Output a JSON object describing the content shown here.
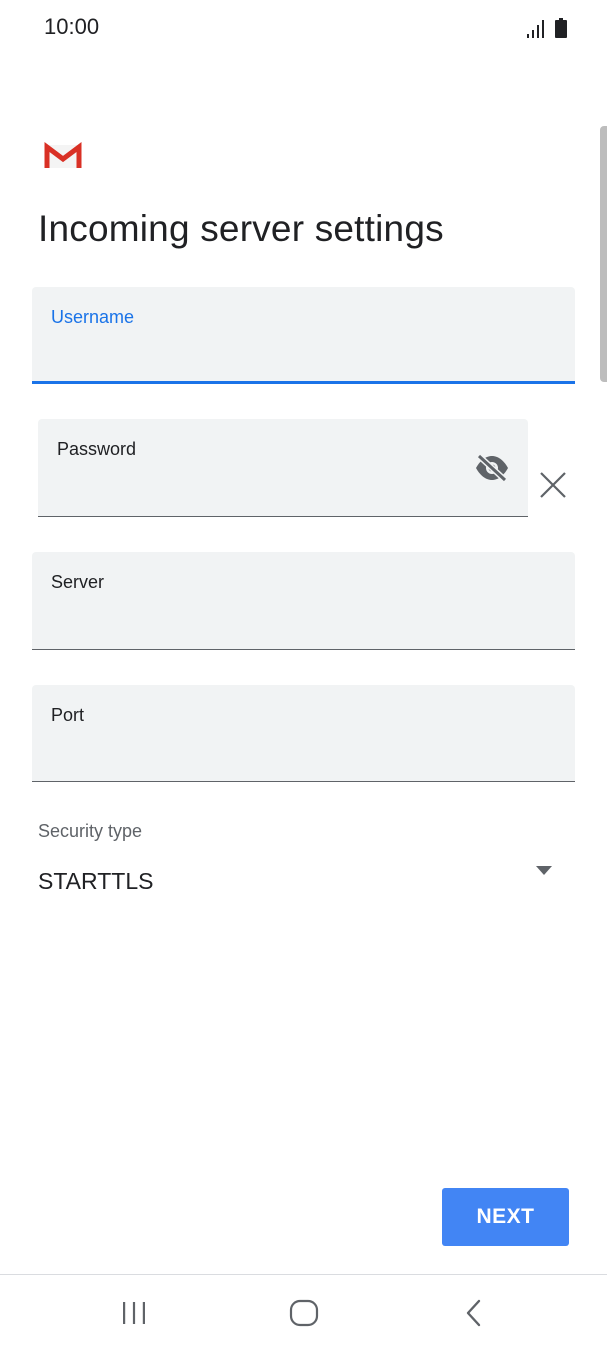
{
  "status_bar": {
    "time": "10:00",
    "icons": [
      "signal-icon",
      "battery-icon"
    ]
  },
  "app": {
    "logo": "gmail-logo-icon",
    "title": "Incoming server settings"
  },
  "form": {
    "username": {
      "label": "Username",
      "value": "",
      "focused": true
    },
    "password": {
      "label": "Password",
      "value": "",
      "visibility_icon": "visibility-off-icon",
      "clear_icon": "close-icon"
    },
    "server": {
      "label": "Server",
      "value": ""
    },
    "port": {
      "label": "Port",
      "value": ""
    },
    "security_type": {
      "label": "Security type",
      "value": "STARTTLS",
      "icon": "dropdown-arrow-icon"
    }
  },
  "actions": {
    "next_label": "NEXT"
  },
  "nav_bar": {
    "items": [
      "recents-icon",
      "home-icon",
      "back-icon"
    ]
  },
  "colors": {
    "accent": "#1a73e8",
    "button": "#4285f4",
    "field_bg": "#f1f3f4",
    "gmail_red": "#d93025"
  }
}
